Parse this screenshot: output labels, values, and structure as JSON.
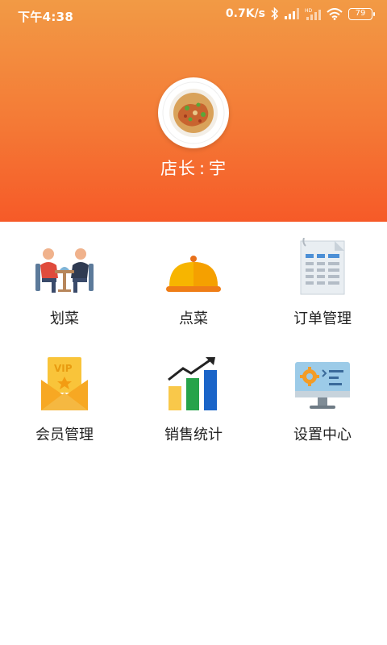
{
  "status_bar": {
    "time": "下午4:38",
    "net_speed": "0.7K/s",
    "battery": "79",
    "icons": [
      "bluetooth-icon",
      "signal-icon",
      "hd-signal-icon",
      "wifi-icon",
      "battery-icon"
    ]
  },
  "profile": {
    "label": "店长",
    "separator": ":",
    "name": "宇"
  },
  "menu": {
    "items": [
      {
        "label": "划菜",
        "icon": "dining-people-icon"
      },
      {
        "label": "点菜",
        "icon": "food-cloche-icon"
      },
      {
        "label": "订单管理",
        "icon": "order-sheet-icon"
      },
      {
        "label": "会员管理",
        "icon": "vip-envelope-icon"
      },
      {
        "label": "销售统计",
        "icon": "sales-chart-icon"
      },
      {
        "label": "设置中心",
        "icon": "settings-monitor-icon"
      }
    ]
  },
  "colors": {
    "header_top": "#f29a45",
    "header_bottom": "#f65a28",
    "text": "#222222"
  }
}
